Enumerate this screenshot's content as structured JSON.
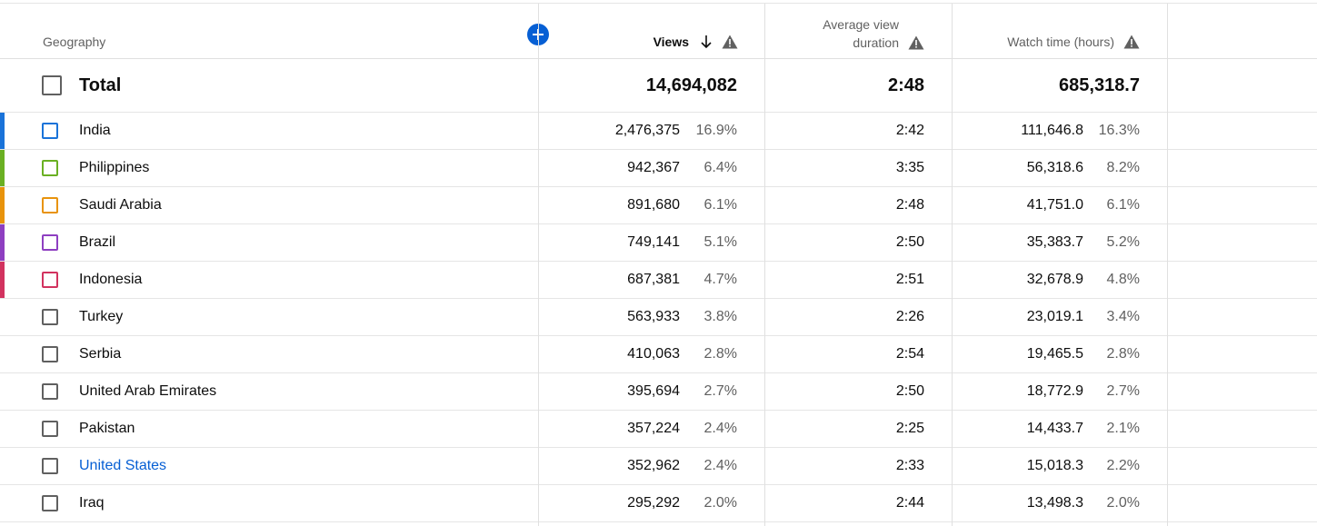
{
  "header": {
    "geography": "Geography",
    "views": "Views",
    "avg_duration_line1": "Average view",
    "avg_duration_line2": "duration",
    "watch_time": "Watch time (hours)"
  },
  "total": {
    "label": "Total",
    "views": "14,694,082",
    "avg_duration": "2:48",
    "watch_time": "685,318.7"
  },
  "rows": [
    {
      "country": "India",
      "views": "2,476,375",
      "views_pct": "16.9%",
      "avg_duration": "2:42",
      "watch_time": "111,646.8",
      "watch_pct": "16.3%",
      "color": "#1a73d9",
      "link": false
    },
    {
      "country": "Philippines",
      "views": "942,367",
      "views_pct": "6.4%",
      "avg_duration": "3:35",
      "watch_time": "56,318.6",
      "watch_pct": "8.2%",
      "color": "#6ab023",
      "link": false
    },
    {
      "country": "Saudi Arabia",
      "views": "891,680",
      "views_pct": "6.1%",
      "avg_duration": "2:48",
      "watch_time": "41,751.0",
      "watch_pct": "6.1%",
      "color": "#e8930c",
      "link": false
    },
    {
      "country": "Brazil",
      "views": "749,141",
      "views_pct": "5.1%",
      "avg_duration": "2:50",
      "watch_time": "35,383.7",
      "watch_pct": "5.2%",
      "color": "#8e3fc1",
      "link": false
    },
    {
      "country": "Indonesia",
      "views": "687,381",
      "views_pct": "4.7%",
      "avg_duration": "2:51",
      "watch_time": "32,678.9",
      "watch_pct": "4.8%",
      "color": "#d2335f",
      "link": false
    },
    {
      "country": "Turkey",
      "views": "563,933",
      "views_pct": "3.8%",
      "avg_duration": "2:26",
      "watch_time": "23,019.1",
      "watch_pct": "3.4%",
      "color": "",
      "link": false
    },
    {
      "country": "Serbia",
      "views": "410,063",
      "views_pct": "2.8%",
      "avg_duration": "2:54",
      "watch_time": "19,465.5",
      "watch_pct": "2.8%",
      "color": "",
      "link": false
    },
    {
      "country": "United Arab Emirates",
      "views": "395,694",
      "views_pct": "2.7%",
      "avg_duration": "2:50",
      "watch_time": "18,772.9",
      "watch_pct": "2.7%",
      "color": "",
      "link": false
    },
    {
      "country": "Pakistan",
      "views": "357,224",
      "views_pct": "2.4%",
      "avg_duration": "2:25",
      "watch_time": "14,433.7",
      "watch_pct": "2.1%",
      "color": "",
      "link": false
    },
    {
      "country": "United States",
      "views": "352,962",
      "views_pct": "2.4%",
      "avg_duration": "2:33",
      "watch_time": "15,018.3",
      "watch_pct": "2.2%",
      "color": "",
      "link": true
    },
    {
      "country": "Iraq",
      "views": "295,292",
      "views_pct": "2.0%",
      "avg_duration": "2:44",
      "watch_time": "13,498.3",
      "watch_pct": "2.0%",
      "color": "",
      "link": false
    }
  ],
  "colors": {
    "accent": "#065fd4",
    "border": "#e0e0e0",
    "secondary_text": "#606060"
  },
  "icons": {
    "add_column": "plus-circle-icon",
    "sort": "arrow-down-icon",
    "warning": "warning-triangle-icon"
  }
}
